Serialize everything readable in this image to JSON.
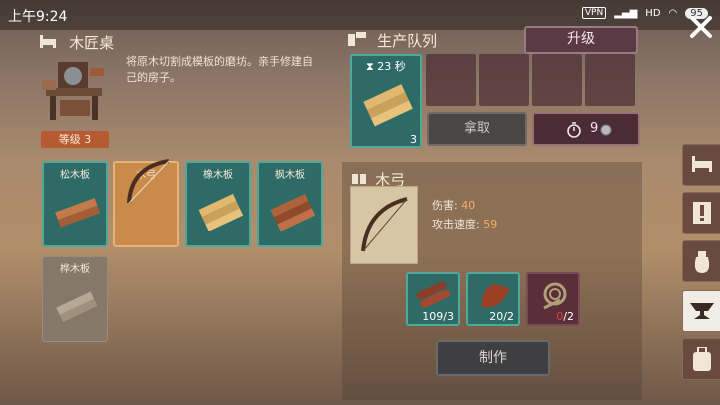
{
  "status_bar": {
    "time": "上午9:24",
    "vpn": "VPN",
    "network": "HD",
    "battery": "95"
  },
  "workbench": {
    "title": "木匠桌",
    "description": "将原木切割成模板的磨坊。亲手修建自己的房子。",
    "level": "等级 3"
  },
  "recipes": [
    {
      "label": "松木板",
      "style": "teal",
      "icon": "planks-icon"
    },
    {
      "label": "木弓",
      "style": "selected",
      "icon": "bow-icon"
    },
    {
      "label": "橡木板",
      "style": "teal",
      "icon": "planks-icon"
    },
    {
      "label": "枫木板",
      "style": "teal",
      "icon": "planks-icon"
    },
    {
      "label": "桦木板",
      "style": "locked",
      "icon": "planks-icon"
    }
  ],
  "queue": {
    "title": "生产队列",
    "upgrade": "升级",
    "timer": "23 秒",
    "item_count": "3",
    "take": "拿取",
    "speedup_cost": "9"
  },
  "detail": {
    "title": "木弓",
    "damage_label": "伤害:",
    "damage_value": "40",
    "speed_label": "攻击速度:",
    "speed_value": "59",
    "materials": [
      {
        "have": "109",
        "need": "/3",
        "icon": "logs-icon",
        "ok": true
      },
      {
        "have": "20",
        "need": "/2",
        "icon": "leather-icon",
        "ok": true
      },
      {
        "have": "0",
        "need": "/2",
        "icon": "rope-icon",
        "ok": false
      }
    ],
    "craft": "制作"
  },
  "colors": {
    "teal_card": "#2f6b66",
    "selected_card": "#c98a4a",
    "level_badge": "#b55a32",
    "accent_value": "#f3b060",
    "missing": "#e04040"
  }
}
